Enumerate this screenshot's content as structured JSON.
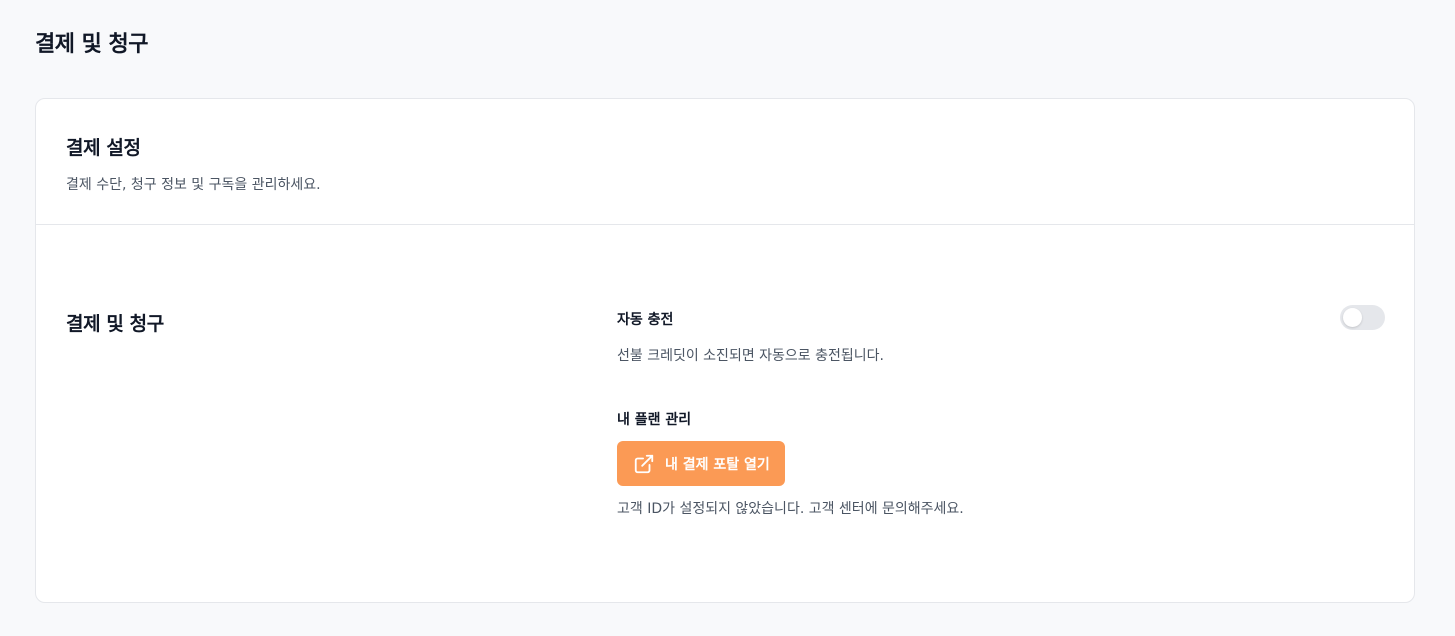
{
  "page": {
    "title": "결제 및 청구"
  },
  "card": {
    "title": "결제 설정",
    "description": "결제 수단, 청구 정보 및 구독을 관리하세요."
  },
  "section": {
    "title": "결제 및 청구"
  },
  "auto_charge": {
    "label": "자동 충전",
    "description": "선불 크레딧이 소진되면 자동으로 충전됩니다.",
    "enabled": false
  },
  "plan": {
    "label": "내 플랜 관리",
    "button_label": "내 결제 포탈 열기",
    "button_icon": "external-link-icon",
    "note": "고객 ID가 설정되지 않았습니다. 고객 센터에 문의해주세요."
  },
  "colors": {
    "accent": "#fb9a55",
    "toggle_off": "#e5e7eb"
  }
}
